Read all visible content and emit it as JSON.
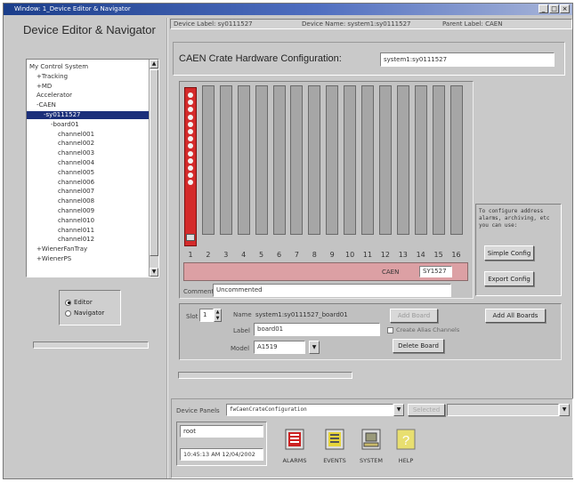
{
  "window": {
    "title": "Window: 1_Device Editor & Navigator",
    "controls": [
      "_",
      "□",
      "×"
    ]
  },
  "sidebar": {
    "app_title": "Device Editor & Navigator",
    "tree": [
      {
        "label": "My Control System",
        "depth": 0,
        "selected": false
      },
      {
        "label": "+Tracking",
        "depth": 1,
        "selected": false
      },
      {
        "label": "+MD",
        "depth": 1,
        "selected": false
      },
      {
        "label": "Accelerator",
        "depth": 1,
        "selected": false
      },
      {
        "label": "-CAEN",
        "depth": 1,
        "selected": false
      },
      {
        "label": "-sy0111527",
        "depth": 2,
        "selected": true
      },
      {
        "label": "-board01",
        "depth": 3,
        "selected": false
      },
      {
        "label": "channel001",
        "depth": 4,
        "selected": false
      },
      {
        "label": "channel002",
        "depth": 4,
        "selected": false
      },
      {
        "label": "channel003",
        "depth": 4,
        "selected": false
      },
      {
        "label": "channel004",
        "depth": 4,
        "selected": false
      },
      {
        "label": "channel005",
        "depth": 4,
        "selected": false
      },
      {
        "label": "channel006",
        "depth": 4,
        "selected": false
      },
      {
        "label": "channel007",
        "depth": 4,
        "selected": false
      },
      {
        "label": "channel008",
        "depth": 4,
        "selected": false
      },
      {
        "label": "channel009",
        "depth": 4,
        "selected": false
      },
      {
        "label": "channel010",
        "depth": 4,
        "selected": false
      },
      {
        "label": "channel011",
        "depth": 4,
        "selected": false
      },
      {
        "label": "channel012",
        "depth": 4,
        "selected": false
      },
      {
        "label": "+WienerFanTray",
        "depth": 1,
        "selected": false
      },
      {
        "label": "+WienerPS",
        "depth": 1,
        "selected": false
      }
    ],
    "mode": {
      "options": [
        "Editor",
        "Navigator"
      ],
      "selected": "Editor"
    }
  },
  "header": {
    "device_label_caption": "Device Label: sy0111527",
    "device_name_caption": "Device Name: system1:sy0111527",
    "parent_label_caption": "Parent Label: CAEN"
  },
  "main": {
    "title": "CAEN Crate Hardware Configuration:",
    "crate_field": "system1:sy0111527",
    "slot_numbers": [
      "1",
      "2",
      "3",
      "4",
      "5",
      "6",
      "7",
      "8",
      "9",
      "10",
      "11",
      "12",
      "13",
      "14",
      "15",
      "16"
    ],
    "occupied_slot": 1,
    "crate_bar_label": "CAEN",
    "crate_bar_value": "SY1527",
    "comment_label": "Comment",
    "comment_value": "Uncommented",
    "info_text": "To configure address alarms, archiving, etc you can use:",
    "simple_config_label": "Simple Config",
    "export_config_label": "Export Config"
  },
  "board": {
    "slot_label": "Slot",
    "slot_value": "1",
    "name_label": "Name",
    "name_value": "system1:sy0111527_board01",
    "label_label": "Label",
    "label_value": "board01",
    "model_label": "Model",
    "model_value": "A1519",
    "add_board_label": "Add Board",
    "create_alias_label": "Create Alias Channels",
    "delete_board_label": "Delete Board",
    "add_all_boards_label": "Add All Boards"
  },
  "footer": {
    "device_panels_label": "Device Panels",
    "device_panels_value": "fwCaenCrateConfiguration",
    "dropdown2_value": "Selected",
    "user": "root",
    "datetime": "10:45:13 AM 12/04/2002",
    "buttons": [
      {
        "label": "ALARMS"
      },
      {
        "label": "EVENTS"
      },
      {
        "label": "SYSTEM"
      },
      {
        "label": "HELP"
      }
    ]
  },
  "colors": {
    "board_red": "#d42a2a",
    "crate_bar": "#dca0a4",
    "titlebar": "#1a3d8a",
    "selection": "#1b2f7a"
  },
  "icons": [
    "alarm-bell-icon",
    "events-bell-icon",
    "system-computer-icon",
    "help-question-icon"
  ]
}
